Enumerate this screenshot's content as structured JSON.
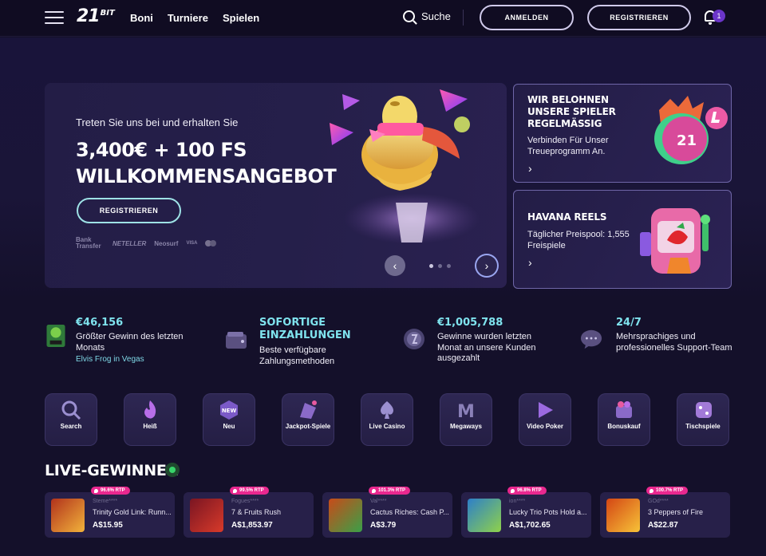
{
  "header": {
    "logo_num": "21",
    "logo_suffix": "BIT",
    "nav": [
      "Boni",
      "Turniere",
      "Spielen"
    ],
    "search_label": "Suche",
    "login": "ANMELDEN",
    "register": "REGISTRIEREN",
    "notification_count": "1"
  },
  "hero": {
    "subtitle": "Treten Sie uns bei und erhalten Sie",
    "title_line1": "3,400€ + 100 FS",
    "title_line2": "WILLKOMMENSANGEBOT",
    "cta": "REGISTRIEREN",
    "payments": [
      "Bank Transfer",
      "NETELLER",
      "Neosurf",
      "VISA"
    ],
    "prev_icon": "chevron-left-icon",
    "next_icon": "chevron-right-icon",
    "slides_total": 3,
    "active_slide": 1
  },
  "promos": [
    {
      "title": "WIR BELOHNEN UNSERE SPIELER REGELMÄSSIG",
      "desc": "Verbinden Für Unser Treueprogramm An.",
      "coin_label": "21"
    },
    {
      "title": "HAVANA REELS",
      "desc": "Täglicher Preispool: 1,555 Freispiele"
    }
  ],
  "stats": [
    {
      "value": "€46,156",
      "text": "Größter Gewinn des letzten Monats",
      "sub": "Elvis Frog in Vegas",
      "icon": "elvis-frog-icon"
    },
    {
      "value": "SOFORTIGE EINZAHLUNGEN",
      "text": "Beste verfügbare Zahlungsmethoden",
      "icon": "wallet-icon"
    },
    {
      "value": "€1,005,788",
      "text": "Gewinne wurden letzten Monat an unsere Kunden ausgezahlt",
      "icon": "coin-icon"
    },
    {
      "value": "24/7",
      "text": "Mehrsprachiges und professionelles Support-Team",
      "icon": "chat-icon"
    }
  ],
  "categories": [
    {
      "label": "Search",
      "icon": "search-icon"
    },
    {
      "label": "Heiß",
      "icon": "flame-icon"
    },
    {
      "label": "Neu",
      "icon": "new-badge-icon",
      "badge": "NEW"
    },
    {
      "label": "Jackpot-Spiele",
      "icon": "jackpot-icon"
    },
    {
      "label": "Live Casino",
      "icon": "spade-icon"
    },
    {
      "label": "Megaways",
      "icon": "megaways-icon",
      "glyph": "M"
    },
    {
      "label": "Video Poker",
      "icon": "play-icon"
    },
    {
      "label": "Bonuskauf",
      "icon": "cart-icon"
    },
    {
      "label": "Tischspiele",
      "icon": "dice-icon"
    }
  ],
  "live": {
    "title": "LIVE-GEWINNER",
    "winners": [
      {
        "rtp": "96.6% RTP",
        "user": "Steme****",
        "game": "Trinity Gold Link: Runn...",
        "amount": "A$15.95",
        "color": "#b1321c"
      },
      {
        "rtp": "99.5% RTP",
        "user": "Fogues****",
        "game": "7 & Fruits Rush",
        "amount": "A$1,853.97",
        "color": "#7a1522"
      },
      {
        "rtp": "101.3% RTP",
        "user": "Val****",
        "game": "Cactus Riches: Cash P...",
        "amount": "A$3.79",
        "color": "#c84b19"
      },
      {
        "rtp": "96.8% RTP",
        "user": "ion****",
        "game": "Lucky Trio Pots Hold a...",
        "amount": "A$1,702.65",
        "color": "#2d7fc9"
      },
      {
        "rtp": "100.7% RTP",
        "user": "GOd****",
        "game": "3 Peppers of Fire",
        "amount": "A$22.87",
        "color": "#d44614"
      }
    ]
  }
}
